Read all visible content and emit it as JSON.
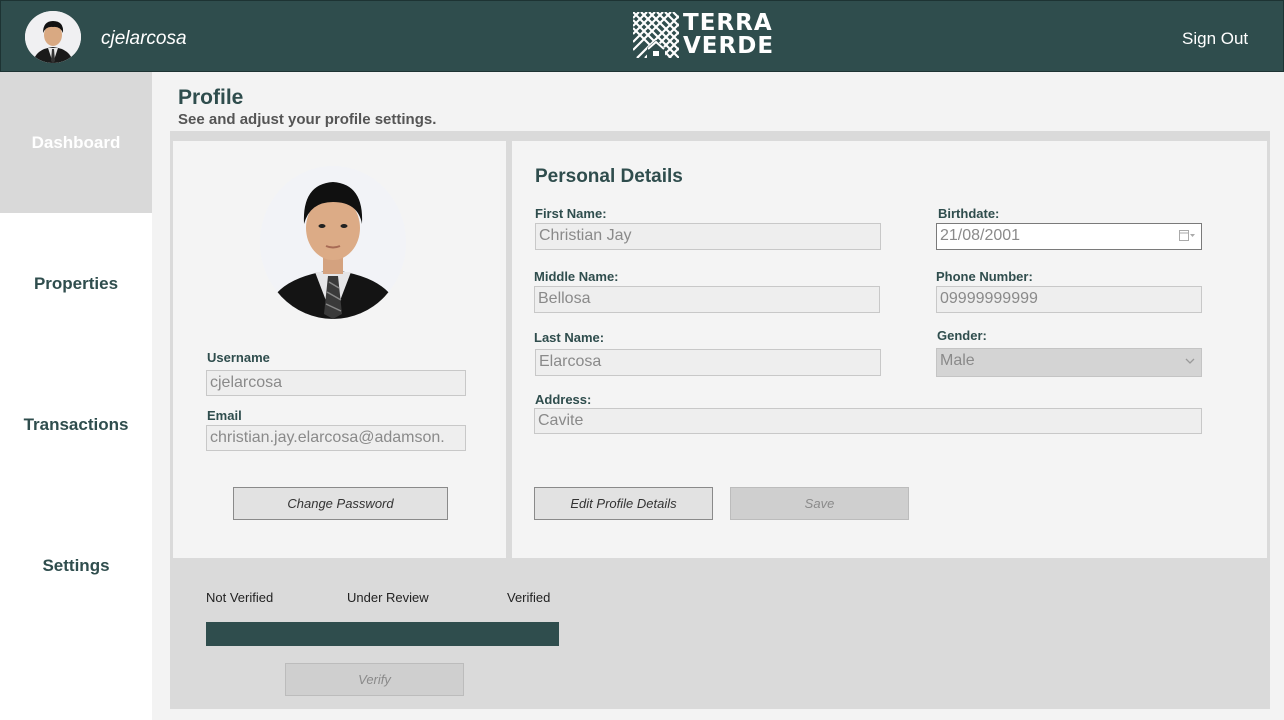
{
  "header": {
    "username": "cjelarcosa",
    "logo_line1": "TERRA",
    "logo_line2": "VERDE",
    "signout_label": "Sign Out"
  },
  "sidebar": {
    "items": [
      {
        "label": "Dashboard",
        "active": true
      },
      {
        "label": "Properties",
        "active": false
      },
      {
        "label": "Transactions",
        "active": false
      },
      {
        "label": "Settings",
        "active": false
      }
    ]
  },
  "page": {
    "title": "Profile",
    "subtitle": "See and adjust your profile settings."
  },
  "account": {
    "username_label": "Username",
    "username_value": "cjelarcosa",
    "email_label": "Email",
    "email_value": "christian.jay.elarcosa@adamson.",
    "change_password_label": "Change Password"
  },
  "personal": {
    "title": "Personal Details",
    "first_name_label": "First Name:",
    "first_name_value": "Christian Jay",
    "middle_name_label": "Middle Name:",
    "middle_name_value": "Bellosa",
    "last_name_label": "Last Name:",
    "last_name_value": "Elarcosa",
    "address_label": "Address:",
    "address_value": "Cavite",
    "birthdate_label": "Birthdate:",
    "birthdate_value": "21/08/2001",
    "phone_label": "Phone Number:",
    "phone_value": "09999999999",
    "gender_label": "Gender:",
    "gender_value": "Male",
    "edit_label": "Edit Profile Details",
    "save_label": "Save"
  },
  "verification": {
    "status_not_verified": "Not Verified",
    "status_under_review": "Under Review",
    "status_verified": "Verified",
    "progress": 1.0,
    "verify_label": "Verify"
  },
  "colors": {
    "brand": "#2f4d4d",
    "sidebar_active": "#d9d9d9",
    "panel": "#f4f4f4"
  }
}
